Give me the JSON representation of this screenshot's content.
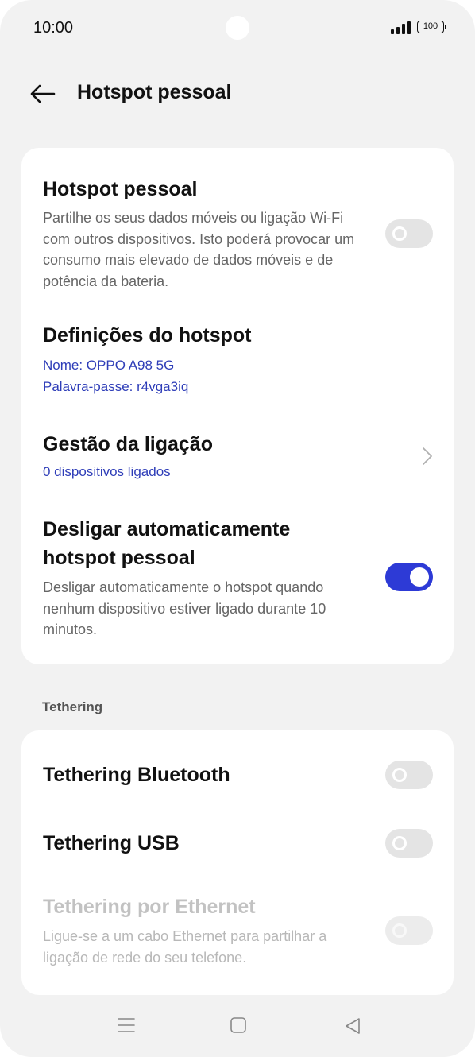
{
  "status_bar": {
    "time": "10:00",
    "battery": "100"
  },
  "header": {
    "title": "Hotspot pessoal",
    "back_icon": "arrow-left-icon"
  },
  "hotspot_card": {
    "personal_hotspot": {
      "title": "Hotspot pessoal",
      "description": "Partilhe os seus dados móveis ou ligação Wi-Fi com outros dispositivos. Isto poderá provocar um consumo mais elevado de dados móveis e de potência da bateria.",
      "enabled": false
    },
    "hotspot_settings": {
      "title": "Definições do hotspot",
      "name_line": "Nome: OPPO A98 5G",
      "password_line": "Palavra-passe: r4vga3iq"
    },
    "connection_management": {
      "title": "Gestão da ligação",
      "subtitle": "0 dispositivos ligados"
    },
    "auto_off": {
      "title_line1": "Desligar automaticamente",
      "title_line2": "hotspot pessoal",
      "description": "Desligar automaticamente o hotspot quando nenhum dispositivo estiver ligado durante 10 minutos.",
      "enabled": true
    }
  },
  "tethering_section": {
    "label": "Tethering",
    "bluetooth": {
      "title": "Tethering Bluetooth",
      "enabled": false
    },
    "usb": {
      "title": "Tethering USB",
      "enabled": false
    },
    "ethernet": {
      "title": "Tethering por Ethernet",
      "description": "Ligue-se a um cabo Ethernet para partilhar a ligação de rede do seu telefone.",
      "enabled": false,
      "disabled": true
    }
  },
  "colors": {
    "accent": "#2d3ad6",
    "link": "#2e3db8",
    "background": "#f2f2f2",
    "card": "#ffffff"
  },
  "nav_bar": {
    "icons": [
      "menu-icon",
      "home-icon",
      "back-triangle-icon"
    ]
  }
}
